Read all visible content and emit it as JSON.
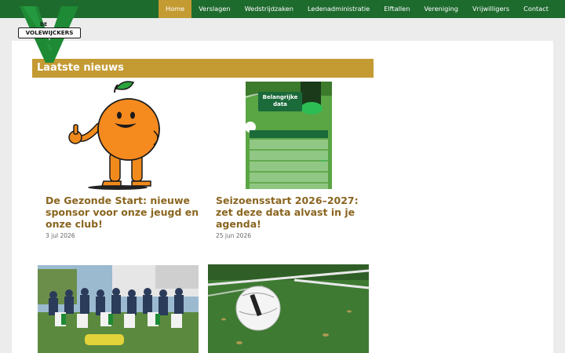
{
  "nav": {
    "items": [
      {
        "label": "Home",
        "active": true
      },
      {
        "label": "Verslagen"
      },
      {
        "label": "Wedstrijdzaken"
      },
      {
        "label": "Ledenadministratie"
      },
      {
        "label": "Elftallen"
      },
      {
        "label": "Vereniging"
      },
      {
        "label": "Vrijwilligers"
      },
      {
        "label": "Contact"
      }
    ]
  },
  "logo": {
    "de": "DE",
    "text": "VOLEWIJCKERS"
  },
  "section": {
    "title": "Laatste nieuws"
  },
  "posts": [
    {
      "title": "De Gezonde Start: nieuwe sponsor voor onze jeugd en onze club!",
      "date": "3 jul 2026"
    },
    {
      "title": "Seizoensstart 2026–2027: zet deze data alvast in je agenda!",
      "date": "25 jun 2026",
      "image_text": "Belangrijke data"
    },
    {
      "title": "",
      "date": ""
    },
    {
      "title": "",
      "date": ""
    }
  ],
  "colors": {
    "green": "#1e6b2e",
    "gold": "#c49a33",
    "title": "#8a6520"
  }
}
